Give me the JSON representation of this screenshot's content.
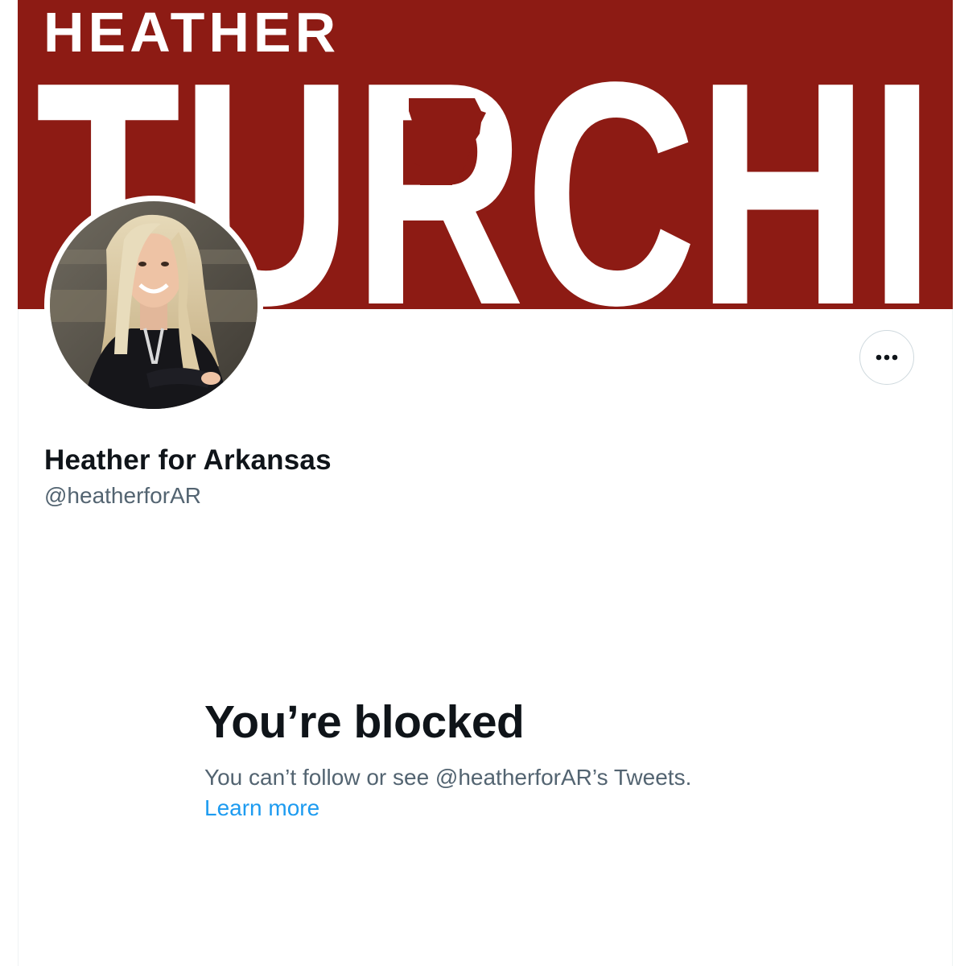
{
  "banner": {
    "line1": "HEATHER",
    "line2": "TURCHI",
    "background_color": "#8d1b14",
    "text_color": "#ffffff"
  },
  "profile": {
    "display_name": "Heather for Arkansas",
    "handle": "@heatherforAR"
  },
  "actions": {
    "more_icon": "more-horizontal-icon"
  },
  "blocked": {
    "title": "You’re blocked",
    "message": "You can’t follow or see @heatherforAR’s Tweets.",
    "learn_more": "Learn more"
  },
  "colors": {
    "primary_text": "#0f1419",
    "secondary_text": "#536471",
    "link": "#1d9bf0",
    "border": "#cfd9de"
  }
}
